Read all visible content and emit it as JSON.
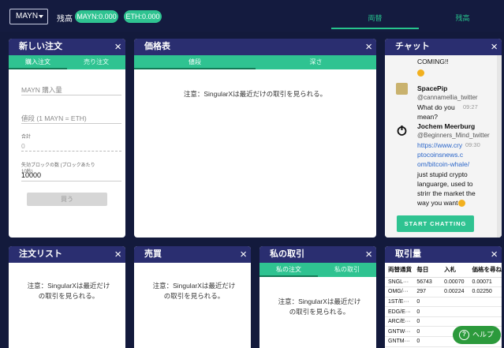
{
  "topbar": {
    "currency_select": "MAYN",
    "balance_label": "残高",
    "balance_mayn": "MAYN:0.000",
    "balance_eth": "ETH:0.000",
    "tab_exchange": "両替",
    "tab_balance": "残高"
  },
  "new_order": {
    "title": "新しい注文",
    "tab_buy": "購入注文",
    "tab_sell": "売り注文",
    "amount_placeholder": "MAYN 購入量",
    "price_placeholder": "値段 (1 MAYN = ETH)",
    "total_label": "合計",
    "total_value": "0",
    "expiry_label": "失効ブロックの数 (ブロックあたり10秒)",
    "expiry_value": "10000",
    "buy_button": "買う"
  },
  "price_chart": {
    "title": "価格表",
    "tab_price": "値段",
    "tab_depth": "深さ",
    "notice": "注意：SingularXは最近だけの取引を見られる。"
  },
  "chat": {
    "title": "チャット",
    "partial_top": "COMING!!",
    "messages": [
      {
        "name": "SpacePip",
        "handle": "@cannamellia_twitter",
        "time": "09:27",
        "lines": [
          "What do you",
          "mean?"
        ]
      },
      {
        "name": "Jochem Meerburg",
        "handle": "@Beginners_Mind_twitter",
        "time": "09:30",
        "link_lines": [
          "https://www.cry",
          "ptocoinsnews.c",
          "om/bitcoin-whale/"
        ],
        "lines": [
          "just stupid crypto",
          "languarge, used to",
          "strirr the market the",
          "way you want"
        ]
      }
    ],
    "start_button": "START CHATTING"
  },
  "order_list": {
    "title": "注文リスト",
    "notice": "注意：SingularXは最近だけの取引を見られる。"
  },
  "trades": {
    "title": "売買",
    "notice": "注意：SingularXは最近だけの取引を見られる。"
  },
  "my_trades": {
    "title": "私の取引",
    "tab_orders": "私の注文",
    "tab_trades": "私の取引",
    "notice": "注意：SingularXは最近だけの取引を見られる。"
  },
  "volume": {
    "title": "取引量",
    "headers": [
      "両替通貨",
      "毎日",
      "入札",
      "価格を尋ね"
    ],
    "rows": [
      [
        "SNGL···",
        "56743",
        "0.00070",
        "0.00071"
      ],
      [
        "OMG/···",
        "297",
        "0.00224",
        "0.02250"
      ],
      [
        "1ST/E···",
        "0",
        "",
        ""
      ],
      [
        "EDG/E···",
        "0",
        "",
        ""
      ],
      [
        "ARC/E···",
        "0",
        "",
        ""
      ],
      [
        "GNTW···",
        "0",
        "",
        ""
      ],
      [
        "GNTM···",
        "0",
        "",
        ""
      ]
    ]
  },
  "help_button": "ヘルプ"
}
